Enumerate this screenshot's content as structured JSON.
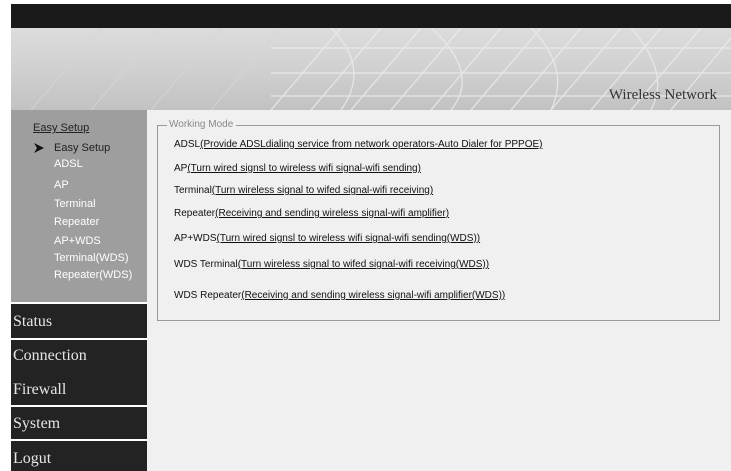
{
  "banner": {
    "title": "Wireless Network"
  },
  "sidebar": {
    "heading": "Easy Setup",
    "items": [
      {
        "label": "Easy Setup"
      },
      {
        "label": "ADSL"
      },
      {
        "label": "AP"
      },
      {
        "label": "Terminal"
      },
      {
        "label": "Repeater"
      },
      {
        "label": "AP+WDS"
      },
      {
        "label": "Terminal(WDS)"
      },
      {
        "label": "Repeater(WDS)"
      }
    ],
    "menu": [
      {
        "label": "Status"
      },
      {
        "label": "Connection"
      },
      {
        "label": "Firewall"
      },
      {
        "label": "System"
      },
      {
        "label": "Logut"
      }
    ]
  },
  "main": {
    "legend": "Working Mode",
    "modes": [
      {
        "name": "ADSL",
        "desc": "(Provide ADSLdialing service from network operators-Auto Dialer for PPPOE)"
      },
      {
        "name": "AP",
        "desc": "(Turn wired signsl to wireless wifi signal-wifi sending)"
      },
      {
        "name": "Terminal",
        "desc": "(Turn wireless signal to wifed signal-wifi receiving)"
      },
      {
        "name": "Repeater",
        "desc": "(Receiving and sending wireless signal-wifi amplifier)"
      },
      {
        "name": "AP+WDS",
        "desc": "(Turn wired signsl to wireless wifi signal-wifi sending(WDS))"
      },
      {
        "name": "WDS Terminal",
        "desc": "(Turn wireless signal to wifed signal-wifi receiving(WDS))"
      },
      {
        "name": "WDS Repeater",
        "desc": "(Receiving and sending wireless signal-wifi amplifier(WDS))"
      }
    ]
  }
}
